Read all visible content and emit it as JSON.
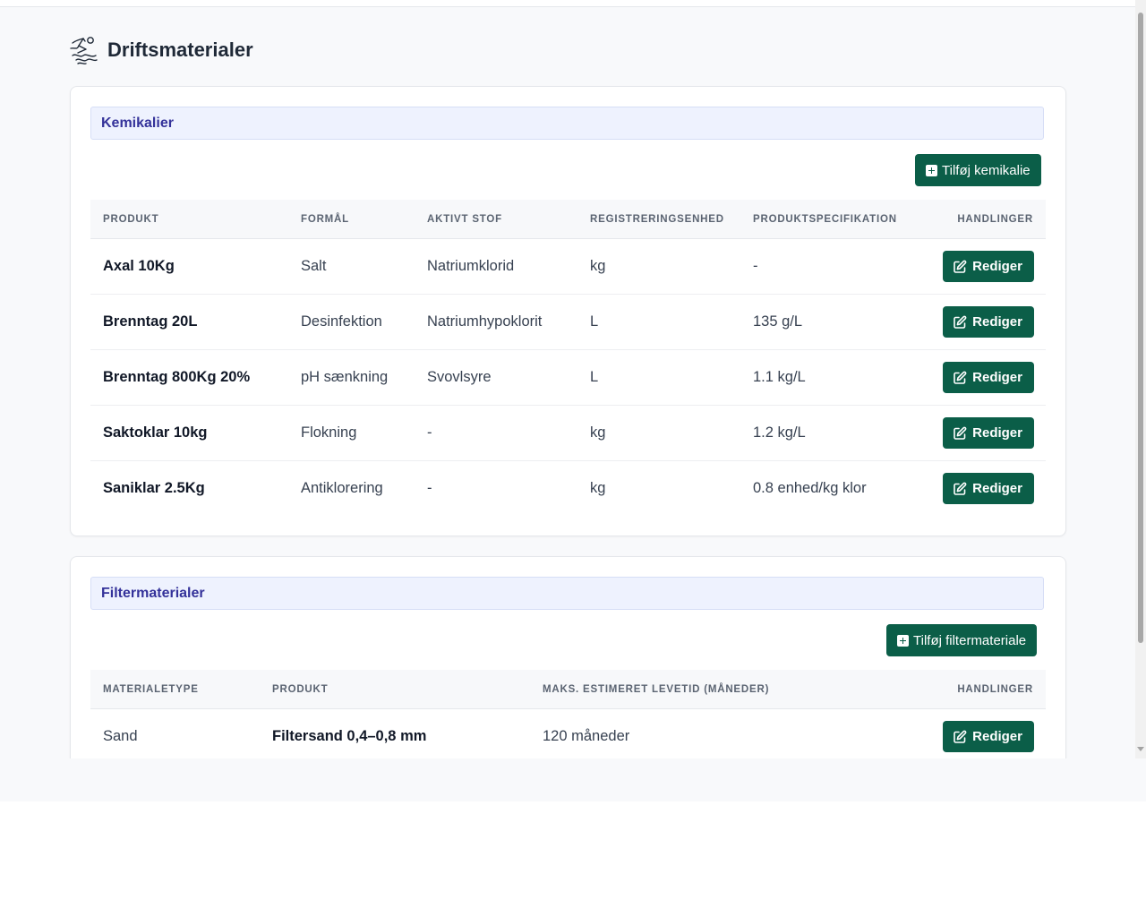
{
  "page": {
    "title": "Driftsmaterialer",
    "logo_icon": "swimmer-icon"
  },
  "colors": {
    "primary": "#0b5e48",
    "section_title": "#34329a",
    "section_bg": "#eef2fe"
  },
  "chemicals": {
    "title": "Kemikalier",
    "add_label": "Tilføj kemikalie",
    "columns": [
      "PRODUKT",
      "FORMÅL",
      "AKTIVT STOF",
      "REGISTRERINGSENHED",
      "PRODUKTSPECIFIKATION",
      "HANDLINGER"
    ],
    "rows": [
      {
        "product": "Axal 10Kg",
        "purpose": "Salt",
        "active": "Natriumklorid",
        "unit": "kg",
        "spec": "-",
        "action": "Rediger"
      },
      {
        "product": "Brenntag 20L",
        "purpose": "Desinfektion",
        "active": "Natriumhypoklorit",
        "unit": "L",
        "spec": "135 g/L",
        "action": "Rediger"
      },
      {
        "product": "Brenntag 800Kg 20%",
        "purpose": "pH sænkning",
        "active": "Svovlsyre",
        "unit": "L",
        "spec": "1.1 kg/L",
        "action": "Rediger"
      },
      {
        "product": "Saktoklar 10kg",
        "purpose": "Flokning",
        "active": "-",
        "unit": "kg",
        "spec": "1.2 kg/L",
        "action": "Rediger"
      },
      {
        "product": "Saniklar 2.5Kg",
        "purpose": "Antiklorering",
        "active": "-",
        "unit": "kg",
        "spec": "0.8 enhed/kg klor",
        "action": "Rediger"
      }
    ]
  },
  "filters": {
    "title": "Filtermaterialer",
    "add_label": "Tilføj filtermateriale",
    "columns": [
      "MATERIALETYPE",
      "PRODUKT",
      "MAKS. ESTIMERET LEVETID (MÅNEDER)",
      "HANDLINGER"
    ],
    "rows": [
      {
        "type": "Sand",
        "product": "Filtersand 0,4–0,8 mm",
        "lifetime": "120 måneder",
        "action": "Rediger"
      }
    ]
  }
}
